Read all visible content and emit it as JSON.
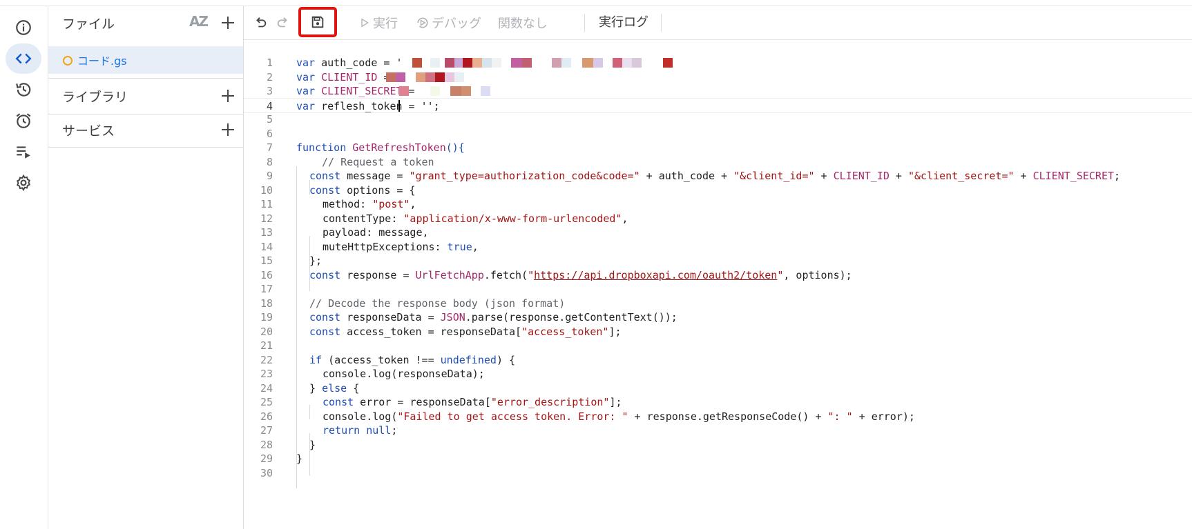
{
  "sidebar_rail": {
    "items": [
      {
        "icon": "info-icon"
      },
      {
        "icon": "code-editor-icon",
        "active": true
      },
      {
        "icon": "history-icon"
      },
      {
        "icon": "alarm-clock-icon"
      },
      {
        "icon": "executions-icon"
      },
      {
        "icon": "gear-icon"
      }
    ]
  },
  "files_panel": {
    "files_title": "ファイル",
    "sort_label": "AZ",
    "active_file": "コード.gs",
    "libraries_title": "ライブラリ",
    "services_title": "サービス"
  },
  "toolbar": {
    "run_label": "実行",
    "debug_label": "デバッグ",
    "function_select": "関数なし",
    "run_log_label": "実行ログ"
  },
  "editor": {
    "line_numbers": [
      "1",
      "2",
      "3",
      "4",
      "5",
      "6",
      "7",
      "8",
      "9",
      "10",
      "11",
      "12",
      "13",
      "14",
      "15",
      "16",
      "17",
      "18",
      "19",
      "20",
      "21",
      "22",
      "23",
      "24",
      "25",
      "26",
      "27",
      "28",
      "29",
      "30"
    ],
    "current_line": "4",
    "lines": {
      "l1_kw": "var",
      "l1_name": "auth_code",
      "l1_rest": " = '",
      "l2_kw": "var",
      "l2_name": "CLIENT_ID",
      "l2_rest": " = ",
      "l3_kw": "var",
      "l3_name": "CLIENT_SECRET",
      "l3_rest": " = ",
      "l4_kw": "var",
      "l4_rest": " reflesh_token = '",
      "l4_end": "';",
      "l7_kw": "function",
      "l7_fn": "GetRefreshToken",
      "l7_rest": "(){",
      "l8": "// Request a token",
      "l9_kw": "const",
      "l9_a": " message = ",
      "l9_s1": "\"grant_type=authorization_code&code=\"",
      "l9_b": " + auth_code + ",
      "l9_s2": "\"&client_id=\"",
      "l9_c": " + ",
      "l9_v1": "CLIENT_ID",
      "l9_d": " + ",
      "l9_s3": "\"&client_secret=\"",
      "l9_e": " + ",
      "l9_v2": "CLIENT_SECRET",
      "l9_f": ";",
      "l10_kw": "const",
      "l10_rest": " options = {",
      "l11_a": "method: ",
      "l11_s": "\"post\"",
      "l11_b": ",",
      "l12_a": "contentType: ",
      "l12_s": "\"application/x-www-form-urlencoded\"",
      "l12_b": ",",
      "l13": "payload: message,",
      "l14_a": "muteHttpExceptions: ",
      "l14_kw": "true",
      "l14_b": ",",
      "l15": "};",
      "l16_kw": "const",
      "l16_a": " response = ",
      "l16_fn": "UrlFetchApp",
      "l16_b": ".fetch(",
      "l16_q1": "\"",
      "l16_url": "https://api.dropboxapi.com/oauth2/token",
      "l16_q2": "\"",
      "l16_c": ", options);",
      "l18": "// Decode the response body (json format)",
      "l19_kw": "const",
      "l19_a": " responseData = ",
      "l19_fn": "JSON",
      "l19_b": ".parse(response.getContentText());",
      "l20_kw": "const",
      "l20_a": " access_token = responseData[",
      "l20_s": "\"access_token\"",
      "l20_b": "];",
      "l22_kw": "if",
      "l22_a": " (access_token !== ",
      "l22_kw2": "undefined",
      "l22_b": ") {",
      "l23": "console.log(responseData);",
      "l24_a": "} ",
      "l24_kw": "else",
      "l24_b": " {",
      "l25_kw": "const",
      "l25_a": " error = responseData[",
      "l25_s": "\"error_description\"",
      "l25_b": "];",
      "l26_a": "console.log(",
      "l26_s1": "\"Failed to get access token. Error: \"",
      "l26_b": " + response.getResponseCode() + ",
      "l26_s2": "\": \"",
      "l26_c": " + error);",
      "l27_kw": "return",
      "l27_kw2": " null",
      "l27_b": ";",
      "l28": "}",
      "l29": "}"
    }
  }
}
